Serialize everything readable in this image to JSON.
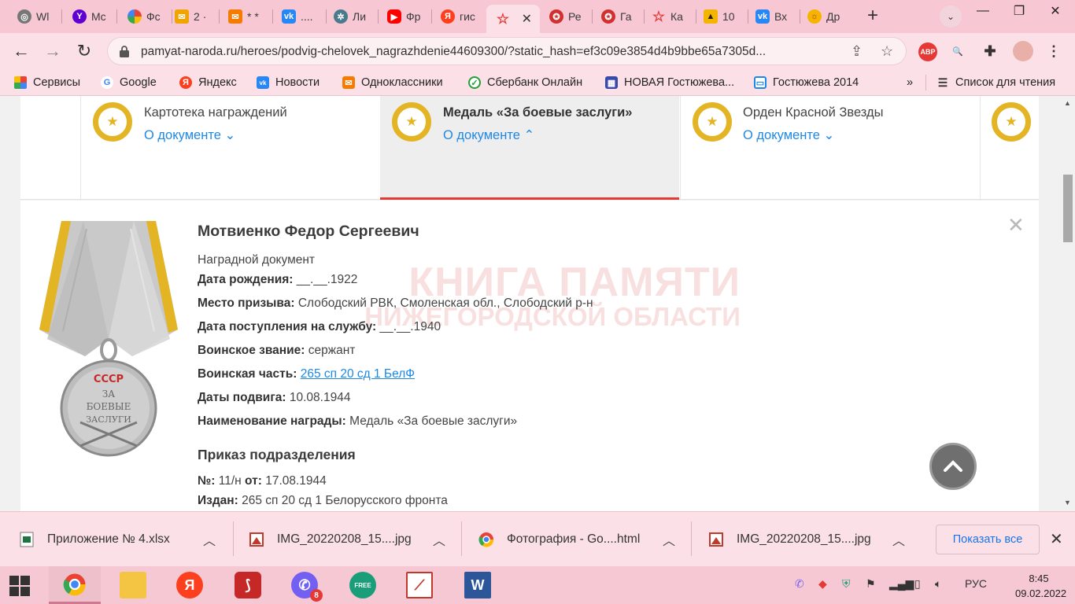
{
  "browser": {
    "tabs": [
      {
        "label": "Wl",
        "icon": "chrome-icon",
        "color": "#555555"
      },
      {
        "label": "Mc",
        "icon": "yahoo-icon",
        "color": "#6001d2"
      },
      {
        "label": "Фс",
        "icon": "google-photos-icon",
        "color": "#f4b400"
      },
      {
        "label": "2 ·",
        "icon": "mail-icon",
        "color": "#f0a400"
      },
      {
        "label": "* *",
        "icon": "mail-icon",
        "color": "#f57c00"
      },
      {
        "label": "....",
        "icon": "vk-icon",
        "color": "#2787f5"
      },
      {
        "label": "Ли",
        "icon": "compass-icon",
        "color": "#4a7b8c"
      },
      {
        "label": "Фр",
        "icon": "youtube-icon",
        "color": "#ff0000"
      },
      {
        "label": "гис",
        "icon": "yandex-icon",
        "color": "#fc3f1d"
      },
      {
        "label": "",
        "icon": "star-icon",
        "color": "#e53935",
        "active": true
      },
      {
        "label": "Ре",
        "icon": "award-icon",
        "color": "#d32f2f"
      },
      {
        "label": "Га",
        "icon": "award-icon",
        "color": "#d32f2f"
      },
      {
        "label": "Ка",
        "icon": "star-icon",
        "color": "#e53935"
      },
      {
        "label": "10",
        "icon": "photo-icon",
        "color": "#f4b400"
      },
      {
        "label": "Вх",
        "icon": "vk-icon",
        "color": "#2787f5"
      },
      {
        "label": "Др",
        "icon": "sun-icon",
        "color": "#f4b400"
      }
    ],
    "url": "pamyat-naroda.ru/heroes/podvig-chelovek_nagrazhdenie44609300/?static_hash=ef3c09e3854d4b9bbe65a7305d...",
    "extensions": {
      "adblock_label": "ABP"
    },
    "bookmarks": [
      {
        "label": "Сервисы",
        "icon": "apps-grid-icon"
      },
      {
        "label": "Google",
        "icon": "google-icon"
      },
      {
        "label": "Яндекс",
        "icon": "yandex-icon"
      },
      {
        "label": "Новости",
        "icon": "vk-icon"
      },
      {
        "label": "Одноклассники",
        "icon": "mail-icon"
      },
      {
        "label": "Сбербанк Онлайн",
        "icon": "sberbank-icon"
      },
      {
        "label": "НОВАЯ Гостюжева...",
        "icon": "calendar-icon"
      },
      {
        "label": "Гостюжева 2014",
        "icon": "table-icon"
      }
    ],
    "bookmarks_more": "»",
    "reading_list": "Список для чтения"
  },
  "awards_strip": [
    {
      "title": "Картотека награждений",
      "link": "О документе",
      "chevron": "⌄",
      "active": false
    },
    {
      "title": "Медаль «За боевые заслуги»",
      "link": "О документе",
      "chevron": "⌃",
      "active": true
    },
    {
      "title": "Орден Красной Звезды",
      "link": "О документе",
      "chevron": "⌄",
      "active": false
    }
  ],
  "record": {
    "name": "Мотвиенко Федор Сергеевич",
    "doc_type": "Наградной документ",
    "fields": [
      {
        "label": "Дата рождения:",
        "value": "__.__.1922"
      },
      {
        "label": "Место призыва:",
        "value": "Слободский РВК, Смоленская обл., Слободский р-н"
      },
      {
        "label": "Дата поступления на службу:",
        "value": "__.__.1940"
      },
      {
        "label": "Воинское звание:",
        "value": "сержант"
      },
      {
        "label": "Воинская часть:",
        "value": "265 сп 20 сд 1 БелФ",
        "link": true
      },
      {
        "label": "Даты подвига:",
        "value": "10.08.1944"
      },
      {
        "label": "Наименование награды:",
        "value": "Медаль «За боевые заслуги»"
      }
    ],
    "order_heading": "Приказ подразделения",
    "order": {
      "number_label": "№:",
      "number_value": "11/н",
      "from_label": "от:",
      "from_value": "17.08.1944",
      "issued_label": "Издан:",
      "issued_value": "265 сп 20 сд 1 Белорусского фронта"
    },
    "watermark_line1": "КНИГА ПАМЯТИ",
    "watermark_line2": "НИЖЕГОРОДСКОЙ ОБЛАСТИ",
    "medal_inscription_top": "СССР",
    "medal_inscription_1": "ЗА",
    "medal_inscription_2": "БОЕВЫЕ",
    "medal_inscription_3": "ЗАСЛУГИ"
  },
  "downloads": [
    {
      "name": "Приложение № 4.xlsx",
      "icon": "excel-file-icon"
    },
    {
      "name": "IMG_20220208_15....jpg",
      "icon": "image-file-icon"
    },
    {
      "name": "Фотография - Go....html",
      "icon": "chrome-icon"
    },
    {
      "name": "IMG_20220208_15....jpg",
      "icon": "image-file-icon"
    }
  ],
  "downloads_show_all": "Показать все",
  "taskbar": {
    "apps": [
      {
        "name": "chrome",
        "active": true
      },
      {
        "name": "file-explorer"
      },
      {
        "name": "yandex-browser",
        "label": "Я"
      },
      {
        "name": "acrobat"
      },
      {
        "name": "viber",
        "badge": "8"
      },
      {
        "name": "vpn-free",
        "label": "FREE"
      },
      {
        "name": "image-viewer"
      },
      {
        "name": "word",
        "label": "W"
      }
    ],
    "language": "РУС",
    "time": "8:45",
    "date": "09.02.2022"
  },
  "colors": {
    "accent_red": "#e53935",
    "link_blue": "#1e88e5",
    "medal_gold": "#e3b424"
  }
}
